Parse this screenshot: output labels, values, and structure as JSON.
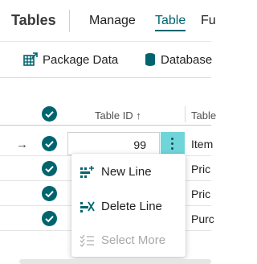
{
  "nav": {
    "title": "Tables",
    "tabs": [
      {
        "label": "Manage",
        "active": false
      },
      {
        "label": "Table",
        "active": true
      },
      {
        "label": "Fu",
        "active": false
      }
    ]
  },
  "actions": [
    {
      "label": "Package Data",
      "icon": "package-data-icon"
    },
    {
      "label": "Database",
      "icon": "database-icon"
    }
  ],
  "grid": {
    "columns": {
      "table_id": "Table ID ↑",
      "table": "Table"
    },
    "rows": [
      {
        "current": true,
        "selected": true,
        "table_id": "99",
        "name": "Item"
      },
      {
        "current": false,
        "selected": true,
        "table_id": "",
        "name": "Pric"
      },
      {
        "current": false,
        "selected": true,
        "table_id": "",
        "name": "Pric"
      },
      {
        "current": false,
        "selected": true,
        "table_id": "",
        "name": "Purc"
      }
    ]
  },
  "context_menu": {
    "items": [
      {
        "label": "New Line",
        "icon": "new-line-icon",
        "enabled": true
      },
      {
        "label": "Delete Line",
        "icon": "delete-line-icon",
        "enabled": true
      },
      {
        "label": "Select More",
        "icon": "select-more-icon",
        "enabled": false
      }
    ]
  },
  "colors": {
    "accent": "#00646f",
    "check_fill": "#00646f",
    "dots_bg": "#6fd5d9"
  }
}
